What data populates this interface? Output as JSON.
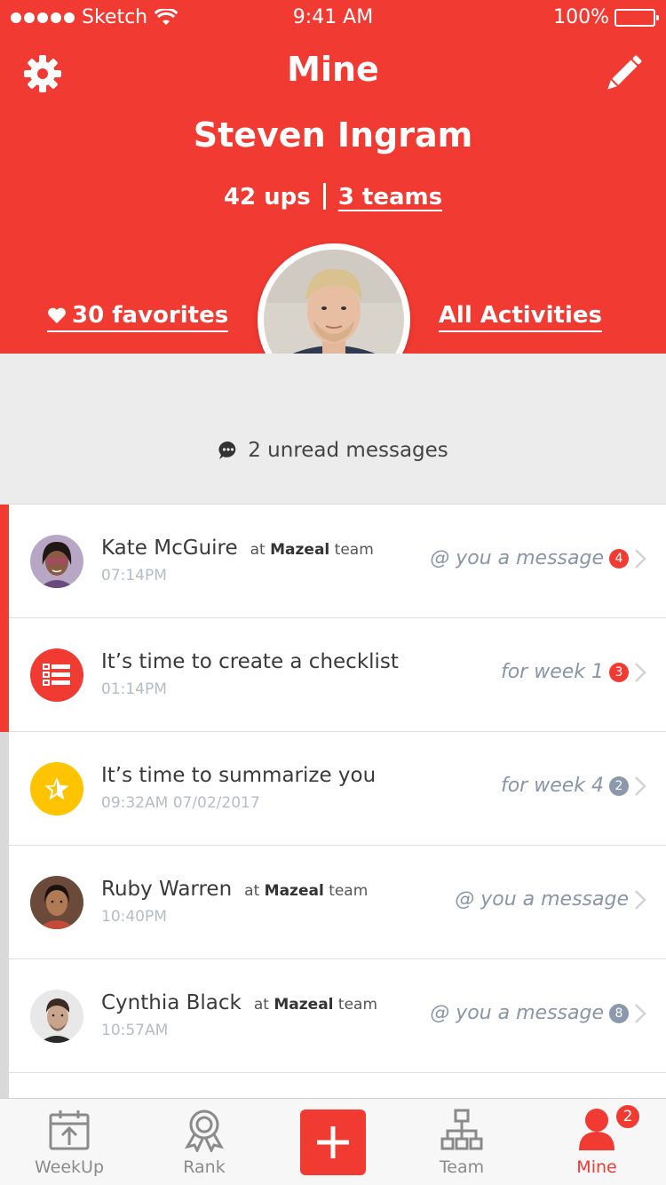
{
  "status_bar": {
    "carrier": "Sketch",
    "time": "9:41 AM",
    "battery": "100%"
  },
  "header": {
    "title": "Mine",
    "name": "Steven Ingram",
    "ups": "42 ups",
    "teams": "3 teams",
    "favorites": "30 favorites",
    "activities": "All Activities"
  },
  "unread": {
    "text": "2 unread messages"
  },
  "list": [
    {
      "primary": "Kate McGuire",
      "at_prefix": "at",
      "team_name": "Mazeal",
      "team_suffix": "team",
      "time": "07:14PM",
      "right_text": "@ you a message",
      "badge": "4",
      "badge_color": "red",
      "accent": "red",
      "icon": "kate-avatar"
    },
    {
      "primary": "It’s time to create a checklist",
      "time": "01:14PM",
      "right_text": "for week 1",
      "badge": "3",
      "badge_color": "red",
      "accent": "red",
      "icon": "checklist-icon"
    },
    {
      "primary": "It’s time to summarize you",
      "time": "09:32AM  07/02/2017",
      "right_text": "for week 4",
      "badge": "2",
      "badge_color": "gray",
      "accent": "gray",
      "icon": "star-icon"
    },
    {
      "primary": "Ruby Warren",
      "at_prefix": "at",
      "team_name": "Mazeal",
      "team_suffix": "team",
      "time": "10:40PM",
      "right_text": "@ you a message",
      "accent": "gray",
      "icon": "ruby-avatar"
    },
    {
      "primary": "Cynthia Black",
      "at_prefix": "at",
      "team_name": "Mazeal",
      "team_suffix": "team",
      "time": "10:57AM",
      "right_text": "@ you a message",
      "badge": "8",
      "badge_color": "gray",
      "accent": "gray",
      "icon": "cynthia-avatar"
    }
  ],
  "tabbar": {
    "tabs": [
      {
        "label": "WeekUp",
        "icon": "weekup-icon"
      },
      {
        "label": "Rank",
        "icon": "rank-icon"
      },
      {
        "label": "",
        "icon": "plus-icon"
      },
      {
        "label": "Team",
        "icon": "team-icon"
      },
      {
        "label": "Mine",
        "icon": "mine-icon",
        "badge": "2",
        "active": true
      }
    ]
  },
  "colors": {
    "accent": "#f03a32",
    "yellow": "#ffc400",
    "badge_gray": "#8c98ab"
  }
}
